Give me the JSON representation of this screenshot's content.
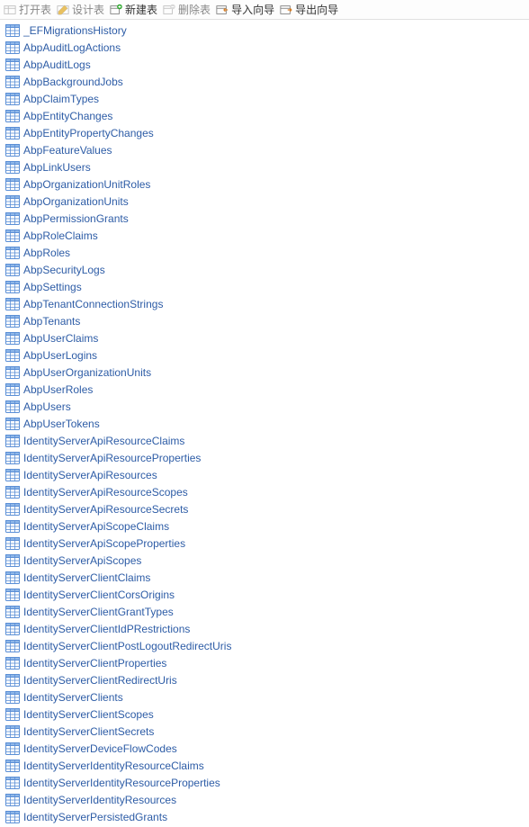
{
  "toolbar": {
    "open_table": {
      "label": "打开表",
      "enabled": false
    },
    "design_table": {
      "label": "设计表",
      "enabled": false
    },
    "new_table": {
      "label": "新建表",
      "enabled": true
    },
    "delete_table": {
      "label": "删除表",
      "enabled": false
    },
    "import_wiz": {
      "label": "导入向导",
      "enabled": true
    },
    "export_wiz": {
      "label": "导出向导",
      "enabled": true
    }
  },
  "tables": [
    "_EFMigrationsHistory",
    "AbpAuditLogActions",
    "AbpAuditLogs",
    "AbpBackgroundJobs",
    "AbpClaimTypes",
    "AbpEntityChanges",
    "AbpEntityPropertyChanges",
    "AbpFeatureValues",
    "AbpLinkUsers",
    "AbpOrganizationUnitRoles",
    "AbpOrganizationUnits",
    "AbpPermissionGrants",
    "AbpRoleClaims",
    "AbpRoles",
    "AbpSecurityLogs",
    "AbpSettings",
    "AbpTenantConnectionStrings",
    "AbpTenants",
    "AbpUserClaims",
    "AbpUserLogins",
    "AbpUserOrganizationUnits",
    "AbpUserRoles",
    "AbpUsers",
    "AbpUserTokens",
    "IdentityServerApiResourceClaims",
    "IdentityServerApiResourceProperties",
    "IdentityServerApiResources",
    "IdentityServerApiResourceScopes",
    "IdentityServerApiResourceSecrets",
    "IdentityServerApiScopeClaims",
    "IdentityServerApiScopeProperties",
    "IdentityServerApiScopes",
    "IdentityServerClientClaims",
    "IdentityServerClientCorsOrigins",
    "IdentityServerClientGrantTypes",
    "IdentityServerClientIdPRestrictions",
    "IdentityServerClientPostLogoutRedirectUris",
    "IdentityServerClientProperties",
    "IdentityServerClientRedirectUris",
    "IdentityServerClients",
    "IdentityServerClientScopes",
    "IdentityServerClientSecrets",
    "IdentityServerDeviceFlowCodes",
    "IdentityServerIdentityResourceClaims",
    "IdentityServerIdentityResourceProperties",
    "IdentityServerIdentityResources",
    "IdentityServerPersistedGrants"
  ]
}
